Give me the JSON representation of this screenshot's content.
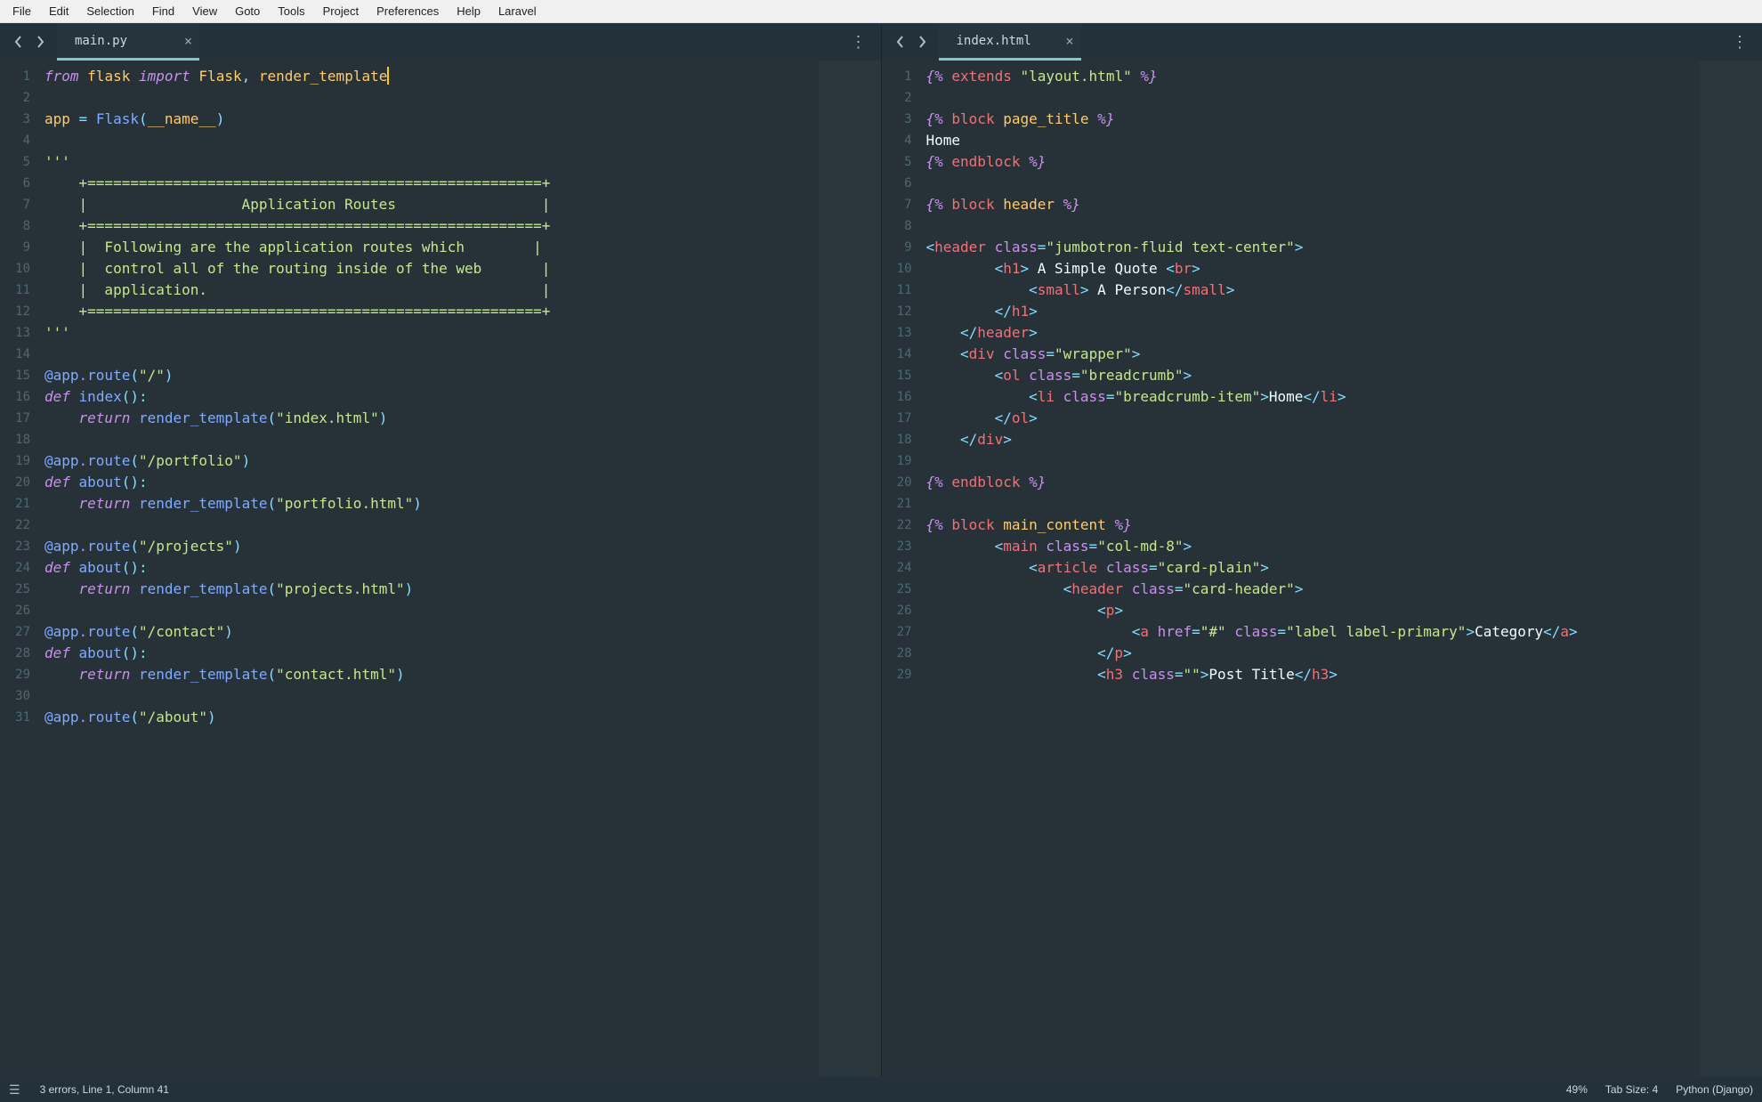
{
  "menu": [
    "File",
    "Edit",
    "Selection",
    "Find",
    "View",
    "Goto",
    "Tools",
    "Project",
    "Preferences",
    "Help",
    "Laravel"
  ],
  "leftPane": {
    "tab": {
      "title": "main.py"
    },
    "gutter": {
      "start": 1,
      "end": 31,
      "markers": [
        23,
        27,
        31
      ]
    },
    "code": [
      {
        "t": "py",
        "segs": [
          [
            "kw",
            "from"
          ],
          [
            "plain",
            " "
          ],
          [
            "ident",
            "flask"
          ],
          [
            "plain",
            " "
          ],
          [
            "kw",
            "import"
          ],
          [
            "plain",
            " "
          ],
          [
            "ident",
            "Flask"
          ],
          [
            "op",
            ", "
          ],
          [
            "ident",
            "render_template"
          ],
          [
            "cursor",
            ""
          ]
        ]
      },
      {
        "t": "blank"
      },
      {
        "t": "py",
        "segs": [
          [
            "ident",
            "app"
          ],
          [
            "plain",
            " "
          ],
          [
            "op",
            "="
          ],
          [
            "plain",
            " "
          ],
          [
            "fn",
            "Flask"
          ],
          [
            "op",
            "("
          ],
          [
            "builtin",
            "__name__"
          ],
          [
            "op",
            ")"
          ]
        ]
      },
      {
        "t": "blank"
      },
      {
        "t": "py",
        "segs": [
          [
            "str",
            "'''"
          ]
        ]
      },
      {
        "t": "cmt",
        "text": "    +=====================================================+"
      },
      {
        "t": "cmt",
        "text": "    |                  Application Routes                 |"
      },
      {
        "t": "cmt",
        "text": "    +=====================================================+"
      },
      {
        "t": "cmt",
        "text": "    |  Following are the application routes which        |"
      },
      {
        "t": "cmt",
        "text": "    |  control all of the routing inside of the web       |"
      },
      {
        "t": "cmt",
        "text": "    |  application.                                       |"
      },
      {
        "t": "cmt",
        "text": "    +=====================================================+"
      },
      {
        "t": "py",
        "segs": [
          [
            "str",
            "'''"
          ]
        ]
      },
      {
        "t": "blank"
      },
      {
        "t": "py",
        "segs": [
          [
            "deco",
            "@app.route"
          ],
          [
            "op",
            "("
          ],
          [
            "str",
            "\"/\""
          ],
          [
            "op",
            ")"
          ]
        ]
      },
      {
        "t": "py",
        "segs": [
          [
            "kw",
            "def"
          ],
          [
            "plain",
            " "
          ],
          [
            "fn",
            "index"
          ],
          [
            "op",
            "():"
          ]
        ]
      },
      {
        "t": "py",
        "segs": [
          [
            "plain",
            "    "
          ],
          [
            "kw",
            "return"
          ],
          [
            "plain",
            " "
          ],
          [
            "fn",
            "render_template"
          ],
          [
            "op",
            "("
          ],
          [
            "str",
            "\"index.html\""
          ],
          [
            "op",
            ")"
          ]
        ]
      },
      {
        "t": "blank"
      },
      {
        "t": "py",
        "segs": [
          [
            "deco",
            "@app.route"
          ],
          [
            "op",
            "("
          ],
          [
            "str",
            "\"/portfolio\""
          ],
          [
            "op",
            ")"
          ]
        ]
      },
      {
        "t": "py",
        "segs": [
          [
            "kw",
            "def"
          ],
          [
            "plain",
            " "
          ],
          [
            "fn",
            "about"
          ],
          [
            "op",
            "():"
          ]
        ]
      },
      {
        "t": "py",
        "segs": [
          [
            "plain",
            "    "
          ],
          [
            "kw",
            "return"
          ],
          [
            "plain",
            " "
          ],
          [
            "fn",
            "render_template"
          ],
          [
            "op",
            "("
          ],
          [
            "str",
            "\"portfolio.html\""
          ],
          [
            "op",
            ")"
          ]
        ]
      },
      {
        "t": "blank"
      },
      {
        "t": "py",
        "segs": [
          [
            "deco",
            "@app.route"
          ],
          [
            "op",
            "("
          ],
          [
            "str",
            "\"/projects\""
          ],
          [
            "op",
            ")"
          ]
        ]
      },
      {
        "t": "py",
        "segs": [
          [
            "kw",
            "def"
          ],
          [
            "plain",
            " "
          ],
          [
            "fn",
            "about"
          ],
          [
            "op",
            "():"
          ]
        ]
      },
      {
        "t": "py",
        "segs": [
          [
            "plain",
            "    "
          ],
          [
            "kw",
            "return"
          ],
          [
            "plain",
            " "
          ],
          [
            "fn",
            "render_template"
          ],
          [
            "op",
            "("
          ],
          [
            "str",
            "\"projects.html\""
          ],
          [
            "op",
            ")"
          ]
        ]
      },
      {
        "t": "blank"
      },
      {
        "t": "py",
        "segs": [
          [
            "deco",
            "@app.route"
          ],
          [
            "op",
            "("
          ],
          [
            "str",
            "\"/contact\""
          ],
          [
            "op",
            ")"
          ]
        ]
      },
      {
        "t": "py",
        "segs": [
          [
            "kw",
            "def"
          ],
          [
            "plain",
            " "
          ],
          [
            "fn",
            "about"
          ],
          [
            "op",
            "():"
          ]
        ]
      },
      {
        "t": "py",
        "segs": [
          [
            "plain",
            "    "
          ],
          [
            "kw",
            "return"
          ],
          [
            "plain",
            " "
          ],
          [
            "fn",
            "render_template"
          ],
          [
            "op",
            "("
          ],
          [
            "str",
            "\"contact.html\""
          ],
          [
            "op",
            ")"
          ]
        ]
      },
      {
        "t": "blank"
      },
      {
        "t": "py",
        "segs": [
          [
            "deco",
            "@app.route"
          ],
          [
            "op",
            "("
          ],
          [
            "str",
            "\"/about\""
          ],
          [
            "op",
            ")"
          ]
        ]
      }
    ]
  },
  "rightPane": {
    "tab": {
      "title": "index.html"
    },
    "gutter": {
      "start": 1,
      "end": 29,
      "markers": []
    },
    "code": [
      {
        "t": "j",
        "segs": [
          [
            "tmpl",
            "{% "
          ],
          [
            "tmplname",
            "extends"
          ],
          [
            "plain",
            " "
          ],
          [
            "str",
            "\"layout.html\""
          ],
          [
            "tmpl",
            " %}"
          ]
        ]
      },
      {
        "t": "blank"
      },
      {
        "t": "j",
        "segs": [
          [
            "tmpl",
            "{% "
          ],
          [
            "tmplname",
            "block"
          ],
          [
            "plain",
            " "
          ],
          [
            "ident",
            "page_title"
          ],
          [
            "tmpl",
            " %}"
          ]
        ]
      },
      {
        "t": "plain",
        "text": "Home"
      },
      {
        "t": "j",
        "segs": [
          [
            "tmpl",
            "{% "
          ],
          [
            "tmplname",
            "endblock"
          ],
          [
            "tmpl",
            " %}"
          ]
        ]
      },
      {
        "t": "blank"
      },
      {
        "t": "j",
        "segs": [
          [
            "tmpl",
            "{% "
          ],
          [
            "tmplname",
            "block"
          ],
          [
            "plain",
            " "
          ],
          [
            "ident",
            "header"
          ],
          [
            "tmpl",
            " %}"
          ]
        ]
      },
      {
        "t": "blank"
      },
      {
        "t": "h",
        "segs": [
          [
            "ang",
            "<"
          ],
          [
            "tag",
            "header"
          ],
          [
            "plain",
            " "
          ],
          [
            "attr",
            "class"
          ],
          [
            "op",
            "="
          ],
          [
            "str",
            "\"jumbotron-fluid text-center\""
          ],
          [
            "ang",
            ">"
          ]
        ]
      },
      {
        "t": "h",
        "segs": [
          [
            "plain",
            "        "
          ],
          [
            "ang",
            "<"
          ],
          [
            "tag",
            "h1"
          ],
          [
            "ang",
            ">"
          ],
          [
            "plain",
            " A Simple Quote "
          ],
          [
            "ang",
            "<"
          ],
          [
            "tag",
            "br"
          ],
          [
            "ang",
            ">"
          ]
        ]
      },
      {
        "t": "h",
        "segs": [
          [
            "plain",
            "            "
          ],
          [
            "ang",
            "<"
          ],
          [
            "tag",
            "small"
          ],
          [
            "ang",
            ">"
          ],
          [
            "plain",
            " A Person"
          ],
          [
            "ang",
            "</"
          ],
          [
            "tag",
            "small"
          ],
          [
            "ang",
            ">"
          ]
        ]
      },
      {
        "t": "h",
        "segs": [
          [
            "plain",
            "        "
          ],
          [
            "ang",
            "</"
          ],
          [
            "tag",
            "h1"
          ],
          [
            "ang",
            ">"
          ]
        ]
      },
      {
        "t": "h",
        "segs": [
          [
            "plain",
            "    "
          ],
          [
            "ang",
            "</"
          ],
          [
            "tag",
            "header"
          ],
          [
            "ang",
            ">"
          ]
        ]
      },
      {
        "t": "h",
        "segs": [
          [
            "plain",
            "    "
          ],
          [
            "ang",
            "<"
          ],
          [
            "tag",
            "div"
          ],
          [
            "plain",
            " "
          ],
          [
            "attr",
            "class"
          ],
          [
            "op",
            "="
          ],
          [
            "str",
            "\"wrapper\""
          ],
          [
            "ang",
            ">"
          ]
        ]
      },
      {
        "t": "h",
        "segs": [
          [
            "plain",
            "        "
          ],
          [
            "ang",
            "<"
          ],
          [
            "tag",
            "ol"
          ],
          [
            "plain",
            " "
          ],
          [
            "attr",
            "class"
          ],
          [
            "op",
            "="
          ],
          [
            "str",
            "\"breadcrumb\""
          ],
          [
            "ang",
            ">"
          ]
        ]
      },
      {
        "t": "h",
        "segs": [
          [
            "plain",
            "            "
          ],
          [
            "ang",
            "<"
          ],
          [
            "tag",
            "li"
          ],
          [
            "plain",
            " "
          ],
          [
            "attr",
            "class"
          ],
          [
            "op",
            "="
          ],
          [
            "str",
            "\"breadcrumb-item\""
          ],
          [
            "ang",
            ">"
          ],
          [
            "plain",
            "Home"
          ],
          [
            "ang",
            "</"
          ],
          [
            "tag",
            "li"
          ],
          [
            "ang",
            ">"
          ]
        ]
      },
      {
        "t": "h",
        "segs": [
          [
            "plain",
            "        "
          ],
          [
            "ang",
            "</"
          ],
          [
            "tag",
            "ol"
          ],
          [
            "ang",
            ">"
          ]
        ]
      },
      {
        "t": "h",
        "segs": [
          [
            "plain",
            "    "
          ],
          [
            "ang",
            "</"
          ],
          [
            "tag",
            "div"
          ],
          [
            "ang",
            ">"
          ]
        ]
      },
      {
        "t": "blank"
      },
      {
        "t": "j",
        "segs": [
          [
            "tmpl",
            "{% "
          ],
          [
            "tmplname",
            "endblock"
          ],
          [
            "tmpl",
            " %}"
          ]
        ]
      },
      {
        "t": "blank"
      },
      {
        "t": "j",
        "segs": [
          [
            "tmpl",
            "{% "
          ],
          [
            "tmplname",
            "block"
          ],
          [
            "plain",
            " "
          ],
          [
            "ident",
            "main_content"
          ],
          [
            "tmpl",
            " %}"
          ]
        ]
      },
      {
        "t": "h",
        "segs": [
          [
            "plain",
            "        "
          ],
          [
            "ang",
            "<"
          ],
          [
            "tag",
            "main"
          ],
          [
            "plain",
            " "
          ],
          [
            "attr",
            "class"
          ],
          [
            "op",
            "="
          ],
          [
            "str",
            "\"col-md-8\""
          ],
          [
            "ang",
            ">"
          ]
        ]
      },
      {
        "t": "h",
        "segs": [
          [
            "plain",
            "            "
          ],
          [
            "ang",
            "<"
          ],
          [
            "tag",
            "article"
          ],
          [
            "plain",
            " "
          ],
          [
            "attr",
            "class"
          ],
          [
            "op",
            "="
          ],
          [
            "str",
            "\"card-plain\""
          ],
          [
            "ang",
            ">"
          ]
        ]
      },
      {
        "t": "h",
        "segs": [
          [
            "plain",
            "                "
          ],
          [
            "ang",
            "<"
          ],
          [
            "tag",
            "header"
          ],
          [
            "plain",
            " "
          ],
          [
            "attr",
            "class"
          ],
          [
            "op",
            "="
          ],
          [
            "str",
            "\"card-header\""
          ],
          [
            "ang",
            ">"
          ]
        ]
      },
      {
        "t": "h",
        "segs": [
          [
            "plain",
            "                    "
          ],
          [
            "ang",
            "<"
          ],
          [
            "tag",
            "p"
          ],
          [
            "ang",
            ">"
          ]
        ]
      },
      {
        "t": "h",
        "segs": [
          [
            "plain",
            "                        "
          ],
          [
            "ang",
            "<"
          ],
          [
            "tag",
            "a"
          ],
          [
            "plain",
            " "
          ],
          [
            "attr",
            "href"
          ],
          [
            "op",
            "="
          ],
          [
            "str",
            "\"#\""
          ],
          [
            "plain",
            " "
          ],
          [
            "attr",
            "class"
          ],
          [
            "op",
            "="
          ],
          [
            "str",
            "\"label label-primary\""
          ],
          [
            "ang",
            ">"
          ],
          [
            "plain",
            "Category"
          ],
          [
            "ang",
            "</"
          ],
          [
            "tag",
            "a"
          ],
          [
            "ang",
            ">"
          ]
        ]
      },
      {
        "t": "h",
        "segs": [
          [
            "plain",
            "                    "
          ],
          [
            "ang",
            "</"
          ],
          [
            "tag",
            "p"
          ],
          [
            "ang",
            ">"
          ]
        ]
      },
      {
        "t": "h",
        "segs": [
          [
            "plain",
            "                    "
          ],
          [
            "ang",
            "<"
          ],
          [
            "tag",
            "h3"
          ],
          [
            "plain",
            " "
          ],
          [
            "attr",
            "class"
          ],
          [
            "op",
            "="
          ],
          [
            "str",
            "\"\""
          ],
          [
            "ang",
            ">"
          ],
          [
            "plain",
            "Post Title"
          ],
          [
            "ang",
            "</"
          ],
          [
            "tag",
            "h3"
          ],
          [
            "ang",
            ">"
          ]
        ]
      }
    ]
  },
  "statusbar": {
    "errors": "3 errors, Line 1, Column 41",
    "zoom": "49%",
    "tabsize": "Tab Size: 4",
    "language": "Python (Django)"
  }
}
